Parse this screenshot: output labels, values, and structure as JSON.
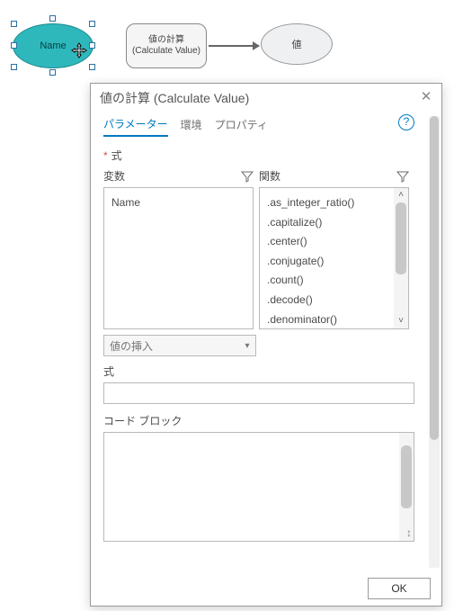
{
  "canvas": {
    "var_name": "Name",
    "calc_label_jp": "値の計算",
    "calc_label_en": "(Calculate Value)",
    "output_label": "値"
  },
  "dialog": {
    "title": "値の計算 (Calculate Value)",
    "tabs": {
      "parameters": "パラメーター",
      "environment": "環境",
      "properties": "プロパティ"
    },
    "help_glyph": "?",
    "required_mark": "*",
    "expr_label": "式",
    "var_header": "変数",
    "func_header": "関数",
    "variables": [
      "Name"
    ],
    "functions": [
      ".as_integer_ratio()",
      ".capitalize()",
      ".center()",
      ".conjugate()",
      ".count()",
      ".decode()",
      ".denominator()"
    ],
    "insert_placeholder": "値の挿入",
    "expr_field_label": "式",
    "codeblock_label": "コード ブロック",
    "ok_label": "OK"
  }
}
